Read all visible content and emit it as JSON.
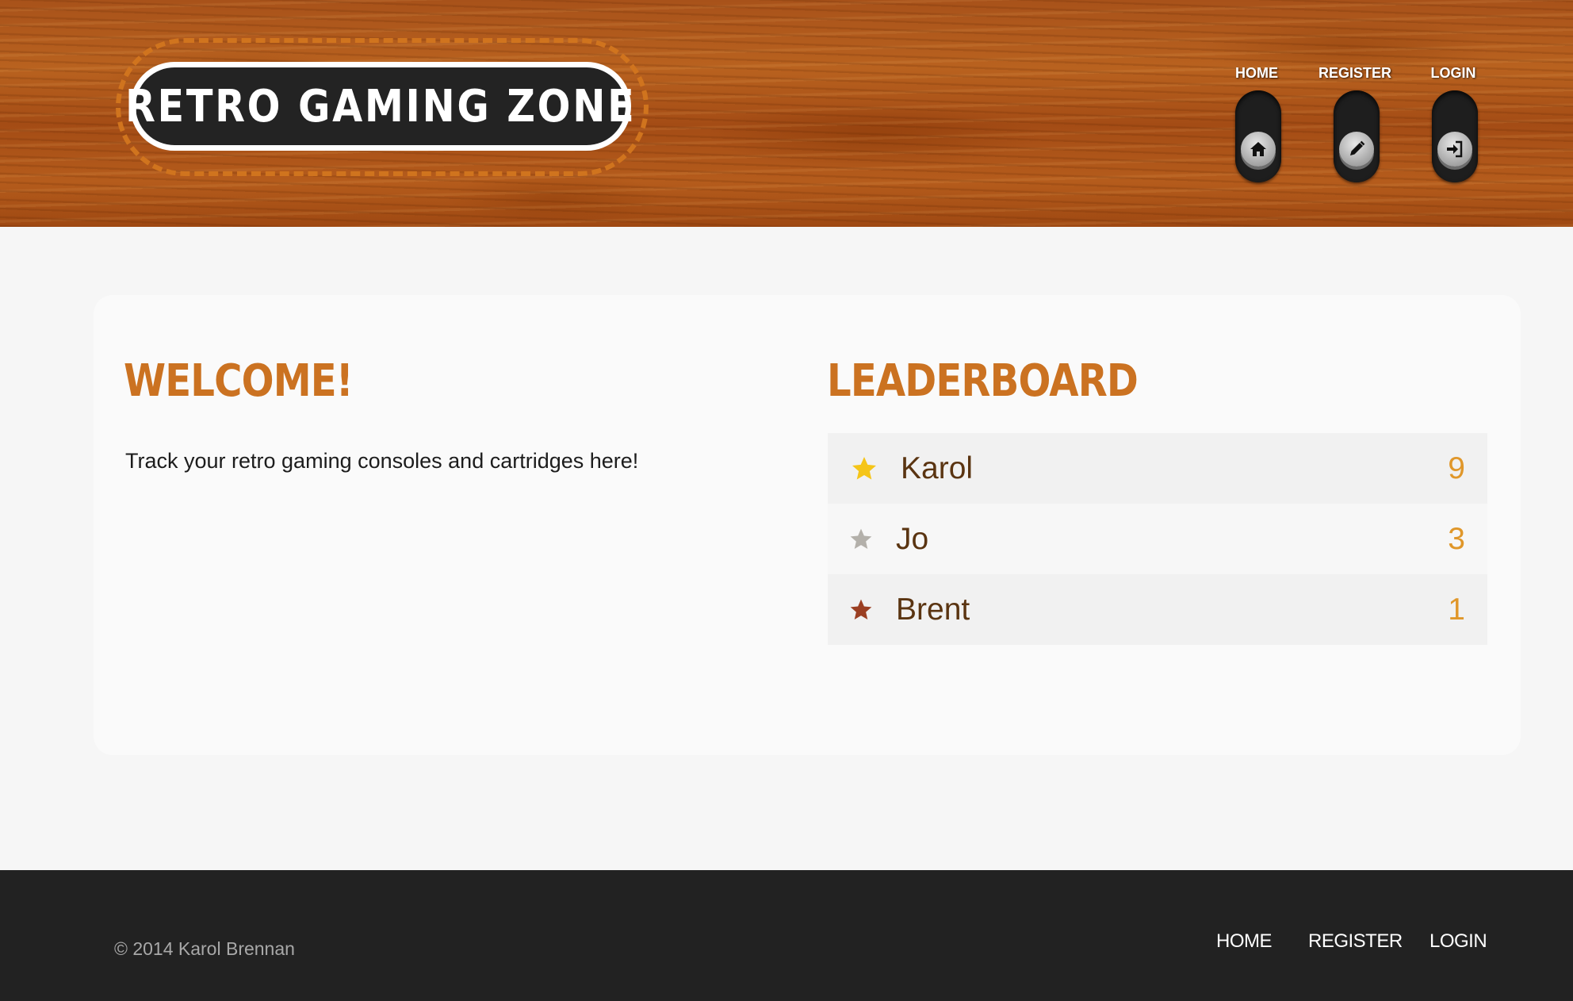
{
  "header": {
    "logo_text": "RETRO GAMING ZONE",
    "nav": [
      {
        "label": "HOME",
        "icon": "home-icon"
      },
      {
        "label": "REGISTER",
        "icon": "pencil-icon"
      },
      {
        "label": "LOGIN",
        "icon": "login-icon"
      }
    ]
  },
  "main": {
    "welcome_title": "WELCOME!",
    "welcome_text": "Track your retro gaming consoles and cartridges here!",
    "leaderboard_title": "LEADERBOARD",
    "leaderboard": [
      {
        "name": "Karol",
        "score": "9",
        "star": "gold-star-icon",
        "star_color": "#f5c518"
      },
      {
        "name": "Jo",
        "score": "3",
        "star": "silver-star-icon",
        "star_color": "#b3b0aa"
      },
      {
        "name": "Brent",
        "score": "1",
        "star": "bronze-star-icon",
        "star_color": "#9b3f22"
      }
    ]
  },
  "footer": {
    "copyright": "© 2014 Karol Brennan",
    "nav": [
      "HOME",
      "REGISTER",
      "LOGIN"
    ]
  },
  "colors": {
    "accent": "#cb7221",
    "score": "#e0972a",
    "footer_bg": "#222222"
  }
}
